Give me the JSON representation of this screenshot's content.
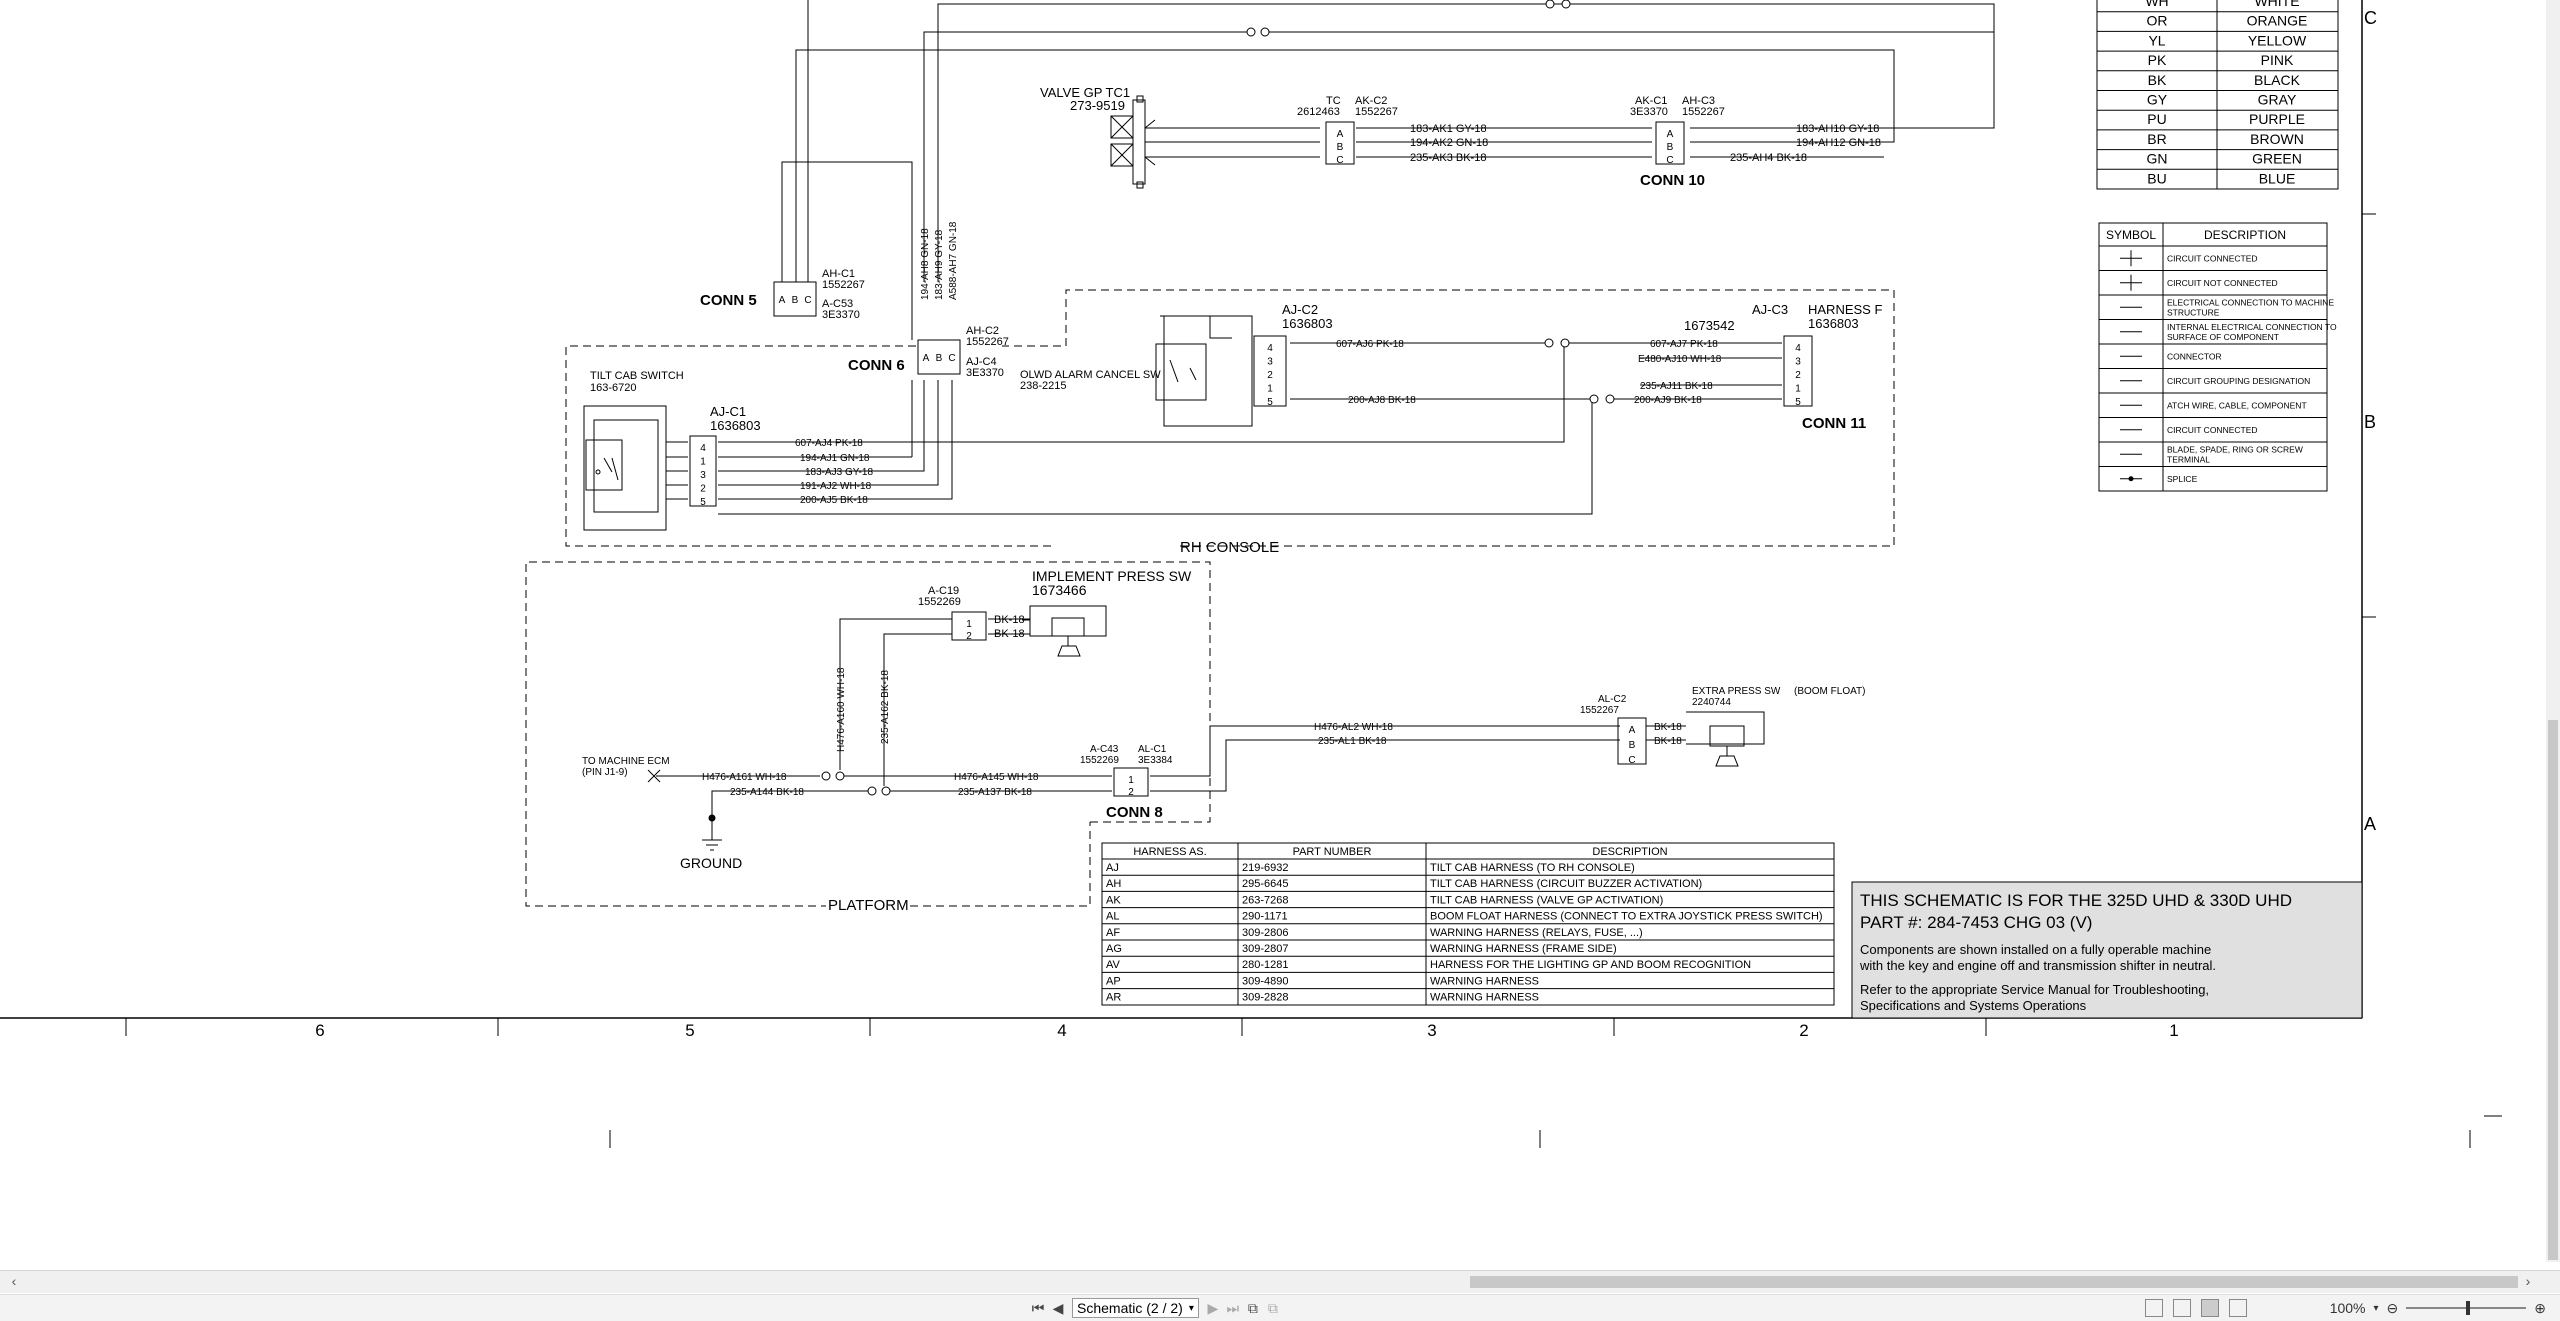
{
  "drawing": {
    "color_legend": [
      {
        "code": "WH",
        "name": "WHITE"
      },
      {
        "code": "OR",
        "name": "ORANGE"
      },
      {
        "code": "YL",
        "name": "YELLOW"
      },
      {
        "code": "PK",
        "name": "PINK"
      },
      {
        "code": "BK",
        "name": "BLACK"
      },
      {
        "code": "GY",
        "name": "GRAY"
      },
      {
        "code": "PU",
        "name": "PURPLE"
      },
      {
        "code": "BR",
        "name": "BROWN"
      },
      {
        "code": "GN",
        "name": "GREEN"
      },
      {
        "code": "BU",
        "name": "BLUE"
      }
    ],
    "symbol_table": {
      "headers": [
        "SYMBOL",
        "DESCRIPTION"
      ],
      "rows": [
        "CIRCUIT CONNECTED",
        "CIRCUIT NOT CONNECTED",
        "ELECTRICAL CONNECTION TO MACHINE STRUCTURE",
        "INTERNAL ELECTRICAL CONNECTION TO SURFACE OF COMPONENT",
        "CONNECTOR",
        "CIRCUIT GROUPING DESIGNATION",
        "ATCH WIRE, CABLE, COMPONENT",
        "CIRCUIT CONNECTED",
        "BLADE, SPADE, RING OR SCREW TERMINAL",
        "SPLICE"
      ]
    },
    "zone_letters": [
      "C",
      "B",
      "A"
    ],
    "zone_numbers": [
      "6",
      "5",
      "4",
      "3",
      "2",
      "1"
    ],
    "components": {
      "valve_gp": {
        "title": "VALVE GP TC1",
        "part": "273-9519"
      },
      "tc": {
        "label": "TC",
        "part": "2612463"
      },
      "ak_c2": {
        "label": "AK-C2",
        "part": "1552267"
      },
      "ak_c1": {
        "label": "AK-C1",
        "part": "3E3370"
      },
      "ah_c3": {
        "label": "AH-C3",
        "part": "1552267"
      },
      "conn10": "CONN 10",
      "ah_c1": {
        "label": "AH-C1",
        "part": "1552267"
      },
      "a_c53": {
        "label": "A-C53",
        "part": "3E3370"
      },
      "conn5": "CONN 5",
      "ah_c2": {
        "label": "AH-C2",
        "part": "1552267"
      },
      "aj_c4": {
        "label": "AJ-C4",
        "part": "3E3370"
      },
      "conn6": "CONN 6",
      "tilt_cab_switch": {
        "title": "TILT CAB SWITCH",
        "part": "163-6720"
      },
      "aj_c1": {
        "label": "AJ-C1",
        "part": "1636803"
      },
      "olwd": {
        "title": "OLWD ALARM CANCEL SW",
        "part": "238-2215"
      },
      "aj_c2": {
        "label": "AJ-C2",
        "part": "1636803"
      },
      "aj_c3": {
        "label": "AJ-C3",
        "part": "1673542"
      },
      "harness_f": {
        "label": "HARNESS F",
        "part": "1636803"
      },
      "conn11": "CONN 11",
      "rh_console": "RH CONSOLE",
      "a_c19": {
        "label": "A-C19",
        "part": "1552269"
      },
      "implement_sw": {
        "title": "IMPLEMENT PRESS SW",
        "part": "1673466"
      },
      "al_c2": {
        "label": "AL-C2",
        "part": "1552267"
      },
      "extra_sw": {
        "title": "EXTRA PRESS SW",
        "part": "2240744"
      },
      "boom_float": "(BOOM FLOAT)",
      "to_ecm": {
        "title": "TO MACHINE ECM",
        "pin": "(PIN J1-9)"
      },
      "a_c43": {
        "label": "A-C43",
        "part": "1552269"
      },
      "al_c1": {
        "label": "AL-C1",
        "part": "3E3384"
      },
      "conn8": "CONN 8",
      "ground": "GROUND",
      "platform": "PLATFORM"
    },
    "wires": {
      "ak1": "183-AK1  GY-18",
      "ak2": "194-AK2  GN-18",
      "ak3": "235-AK3  BK-18",
      "ah10": "183-AH10  GY-18",
      "ah12": "194-AH12  GN-18",
      "ah4": "235-AH4  BK-18",
      "ah_vert": [
        "194-AH8  GN-18",
        "183-AH9  GY-18",
        "A588-AH7  GN-18"
      ],
      "aj4": "607-AJ4  PK-18",
      "aj1": "194-AJ1  GN-18",
      "aj3": "183-AJ3  GY-18",
      "aj2": "191-AJ2  WH-18",
      "aj5": "200-AJ5  BK-18",
      "aj6": "607-AJ6  PK-18",
      "aj8": "200-AJ8  BK-18",
      "aj7": "607-AJ7  PK-18",
      "aj10": "E480-AJ10  WH-18",
      "aj11": "235-AJ11  BK-18",
      "aj9": "200-AJ9  BK-18",
      "bk18": "BK-18",
      "a160": "H476-A160  WH-18",
      "a162": "235-A162  BK-18",
      "a161": "H476-A161  WH-18",
      "a144": "235-A144  BK-18",
      "a145": "H476-A145  WH-18",
      "a137": "235-A137  BK-18",
      "al2": "H476-AL2  WH-18",
      "al1": "235-AL1  BK-18"
    },
    "harness_table": {
      "headers": [
        "HARNESS AS.",
        "PART NUMBER",
        "DESCRIPTION"
      ],
      "rows": [
        [
          "AJ",
          "219-6932",
          "TILT CAB HARNESS  (TO RH CONSOLE)"
        ],
        [
          "AH",
          "295-6645",
          "TILT CAB HARNESS (CIRCUIT BUZZER ACTIVATION)"
        ],
        [
          "AK",
          "263-7268",
          "TILT CAB HARNESS (VALVE GP ACTIVATION)"
        ],
        [
          "AL",
          "290-1171",
          "BOOM FLOAT HARNESS (CONNECT TO EXTRA JOYSTICK PRESS SWITCH)"
        ],
        [
          "AF",
          "309-2806",
          "WARNING HARNESS (RELAYS, FUSE, ...)"
        ],
        [
          "AG",
          "309-2807",
          "WARNING HARNESS (FRAME SIDE)"
        ],
        [
          "AV",
          "280-1281",
          "HARNESS FOR THE LIGHTING GP AND BOOM RECOGNITION"
        ],
        [
          "AP",
          "309-4890",
          "WARNING HARNESS"
        ],
        [
          "AR",
          "309-2828",
          "WARNING HARNESS"
        ]
      ]
    },
    "title_block": {
      "line1": "THIS SCHEMATIC IS FOR THE 325D UHD & 330D UHD",
      "line2": "PART #: 284-7453 CHG 03 (V)",
      "note1a": "Components are shown installed on a fully operable machine",
      "note1b": "with the key and engine off and transmission shifter in neutral.",
      "note2a": "Refer to the appropriate Service Manual for Troubleshooting,",
      "note2b": "Specifications and Systems Operations"
    }
  },
  "viewer": {
    "page_select": "Schematic (2 / 2)",
    "zoom": "100%",
    "icons": {
      "first": "first-page-icon",
      "prev": "previous-page-icon",
      "next": "next-page-icon",
      "last": "last-page-icon"
    }
  }
}
